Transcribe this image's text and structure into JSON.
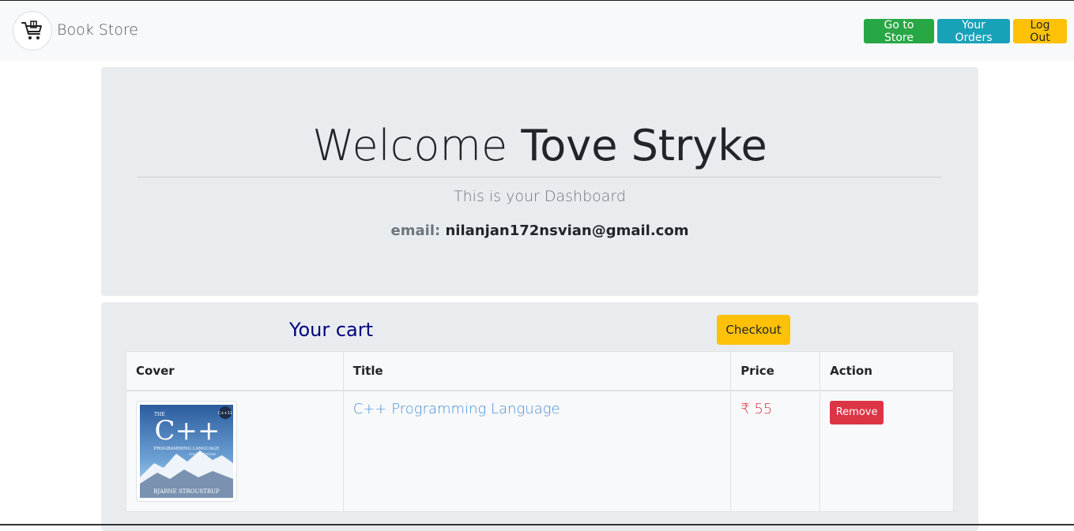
{
  "navbar": {
    "brand": "Book Store",
    "logo_icon": "shopping-cart-icon",
    "buttons": {
      "store": "Go to Store",
      "orders": "Your Orders",
      "logout": "Log Out"
    }
  },
  "dashboard": {
    "welcome_prefix": "Welcome",
    "user_name": "Tove Stryke",
    "subtitle": "This is your Dashboard",
    "email_label": "email:",
    "email_value": "nilanjan172nsvian@gmail.com"
  },
  "cart": {
    "title": "Your cart",
    "checkout_label": "Checkout",
    "columns": [
      "Cover",
      "Title",
      "Price",
      "Action"
    ],
    "items": [
      {
        "cover_text": {
          "the": "THE",
          "main": "C++",
          "sub": "PROGRAMMING LANGUAGE",
          "edition": "FOURTH EDITION",
          "badge": "C++11",
          "author": "BJARNE STROUSTRUP"
        },
        "title": "C++ Programming Language",
        "price": "₹ 55",
        "action_label": "Remove"
      }
    ]
  },
  "colors": {
    "success": "#28a745",
    "info": "#17a2b8",
    "warning": "#ffc107",
    "danger": "#dc3545",
    "cart_title": "#000080"
  }
}
